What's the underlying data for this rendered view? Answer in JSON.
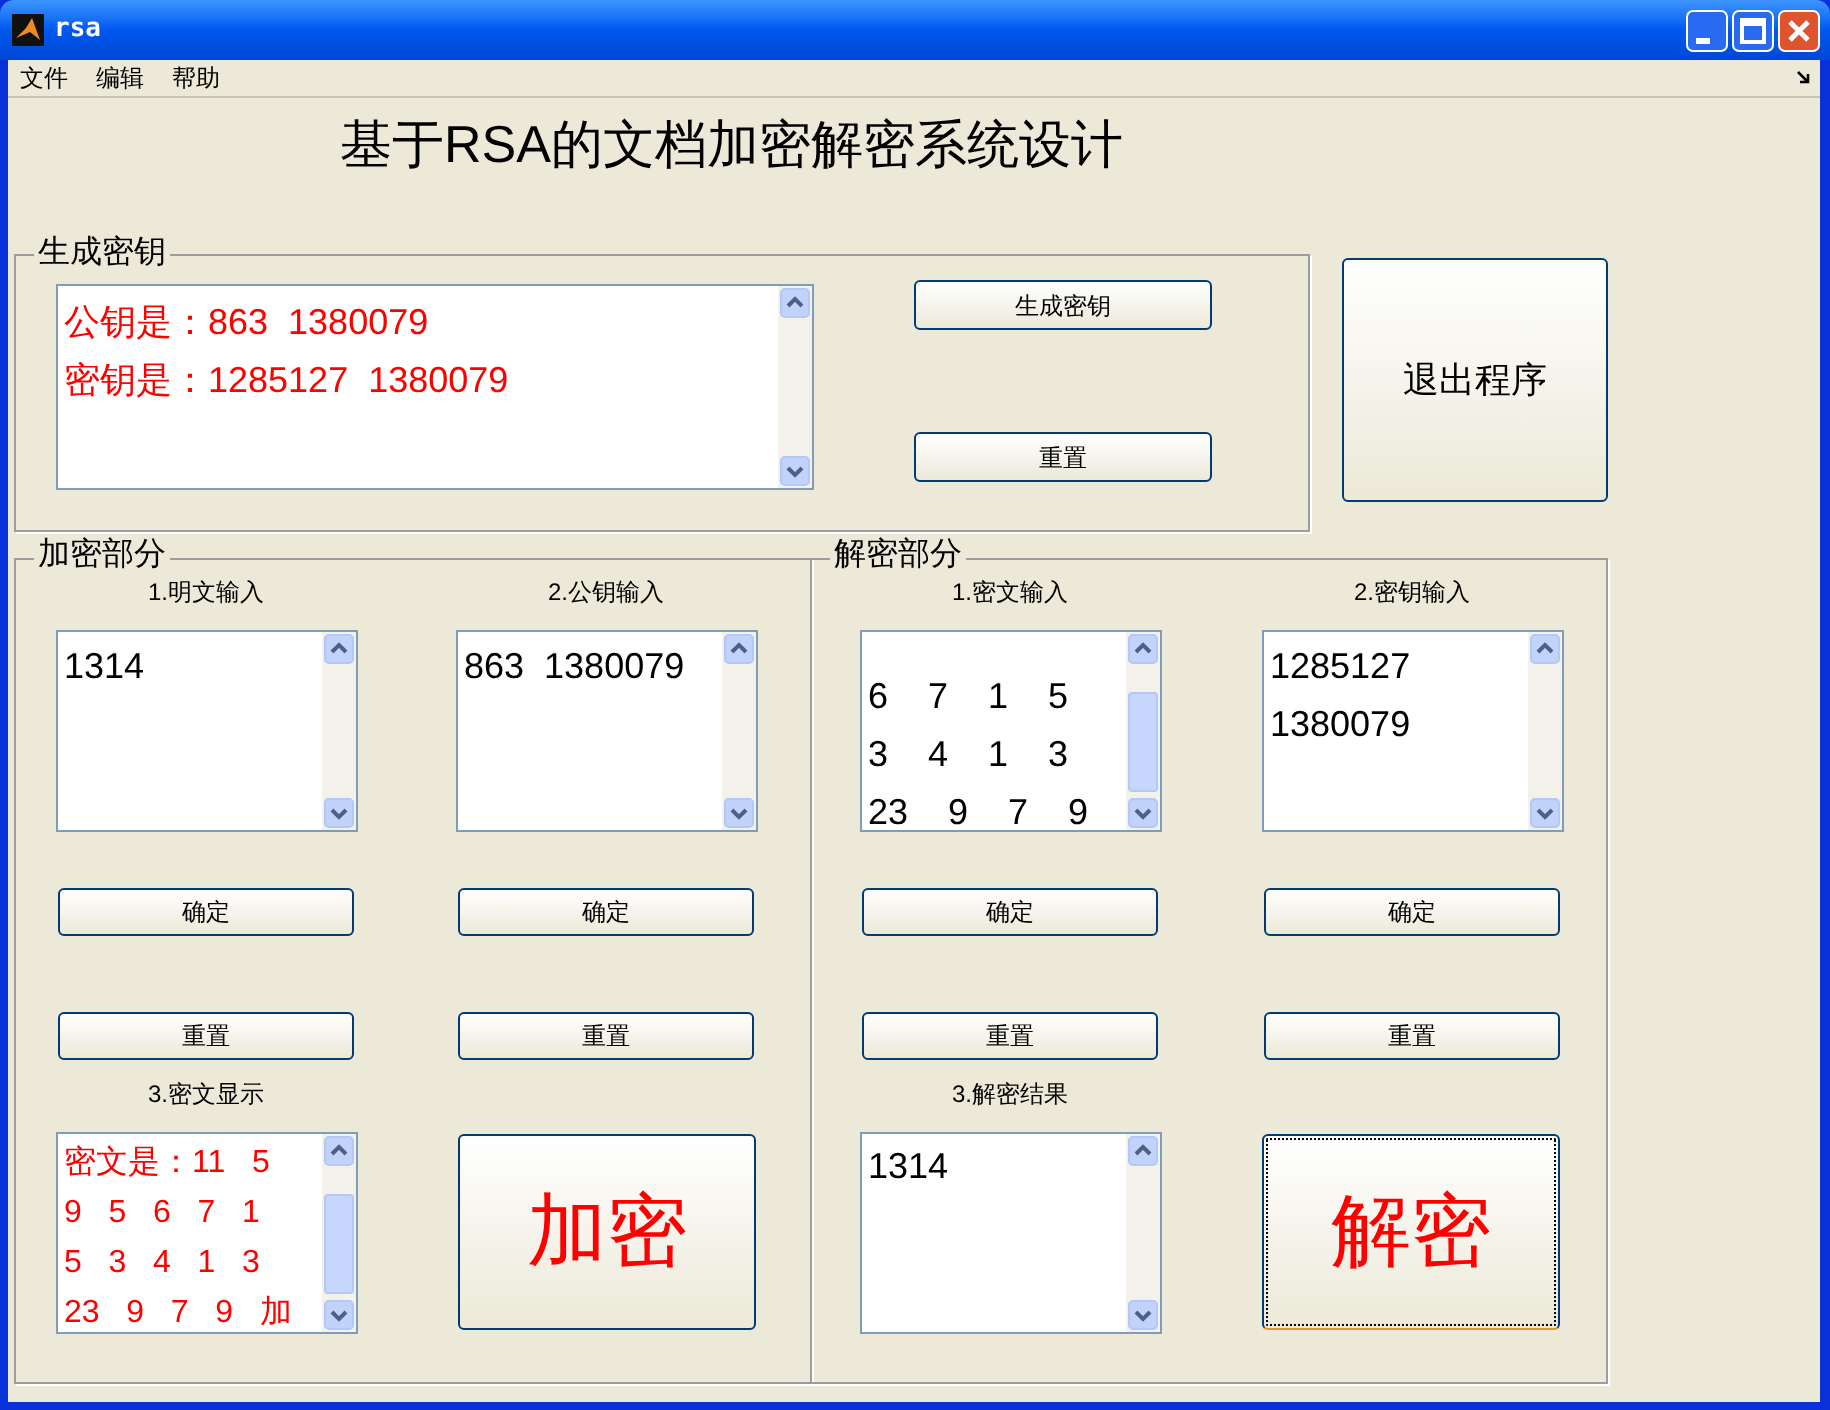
{
  "window": {
    "title": "rsa"
  },
  "menu": [
    {
      "label": "文件"
    },
    {
      "label": "编辑"
    },
    {
      "label": "帮助"
    }
  ],
  "heading": "基于RSA的文档加密解密系统设计",
  "key_panel": {
    "title": "生成密钥",
    "textbox": {
      "kind": "output",
      "lines": [
        "公钥是：863  1380079",
        "密钥是：1285127  1380079"
      ]
    },
    "buttons": [
      {
        "label": "生成密钥"
      },
      {
        "label": "重置"
      }
    ]
  },
  "exit_button": {
    "label": "退出程序"
  },
  "panels": [
    {
      "title": "加密部分",
      "columns": [
        {
          "label": "1.明文输入",
          "textbox": {
            "kind": "input",
            "lines": [
              "1314"
            ]
          },
          "buttons": [
            {
              "label": "确定"
            },
            {
              "label": "重置"
            }
          ]
        },
        {
          "label": "2.公钥输入",
          "textbox": {
            "kind": "input",
            "lines": [
              "863  1380079"
            ]
          },
          "buttons": [
            {
              "label": "确定"
            },
            {
              "label": "重置"
            }
          ]
        }
      ],
      "result": {
        "label": "3.密文显示",
        "textbox": {
          "kind": "output",
          "lines": [
            "密文是：11   5",
            "9   5   6   7   1",
            "5   3   4   1   3",
            "23   9   7   9   加"
          ]
        }
      },
      "action_button": {
        "label": "加密",
        "focused": false
      }
    },
    {
      "title": "解密部分",
      "columns": [
        {
          "label": "1.密文输入",
          "textbox": {
            "kind": "input",
            "lines": [
              "6    7    1    5",
              "3    4    1    3",
              "23    9    7    9"
            ]
          },
          "buttons": [
            {
              "label": "确定"
            },
            {
              "label": "重置"
            }
          ]
        },
        {
          "label": "2.密钥输入",
          "textbox": {
            "kind": "input",
            "lines": [
              "1285127",
              "1380079"
            ]
          },
          "buttons": [
            {
              "label": "确定"
            },
            {
              "label": "重置"
            }
          ]
        }
      ],
      "result": {
        "label": "3.解密结果",
        "textbox": {
          "kind": "input",
          "lines": [
            "1314"
          ]
        }
      },
      "action_button": {
        "label": "解密",
        "focused": true
      }
    }
  ]
}
